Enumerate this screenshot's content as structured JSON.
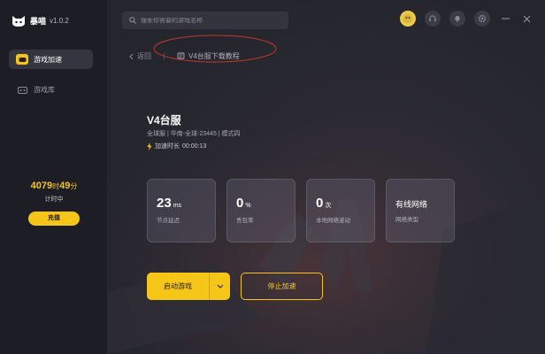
{
  "app": {
    "name": "暴喵",
    "version": "v1.0.2"
  },
  "sidebar": {
    "items": [
      {
        "label": "游戏加速",
        "icon": "gamepad-icon",
        "active": true
      },
      {
        "label": "游戏库",
        "icon": "game-library-icon",
        "active": false
      }
    ],
    "timer": {
      "hours": "4079",
      "hours_unit": "时",
      "minutes": "49",
      "minutes_unit": "分",
      "status": "计时中"
    },
    "recharge_label": "充值"
  },
  "search": {
    "placeholder": "搜索你需要的游戏名称"
  },
  "breadcrumb": {
    "back_label": "返回",
    "guide_label": "V4台服下载教程"
  },
  "game": {
    "title": "V4台服",
    "info": "全球服 | 华南-全球-23445 | 模式四",
    "accel_label": "加速时长",
    "accel_time": "00:00:13"
  },
  "stats": [
    {
      "value": "23",
      "unit": "ms",
      "label": "节点延迟"
    },
    {
      "value": "0",
      "unit": "%",
      "label": "丢包率"
    },
    {
      "value": "0",
      "unit": "次",
      "label": "本地网络波动"
    },
    {
      "value": "有线网络",
      "unit": "",
      "label": "网络类型"
    }
  ],
  "actions": {
    "start_label": "启动游戏",
    "stop_label": "停止加速"
  },
  "colors": {
    "accent": "#f5c518",
    "sidebar_bg": "#1c1d25",
    "main_bg": "#2b2a33",
    "annotation": "#c0392b"
  }
}
